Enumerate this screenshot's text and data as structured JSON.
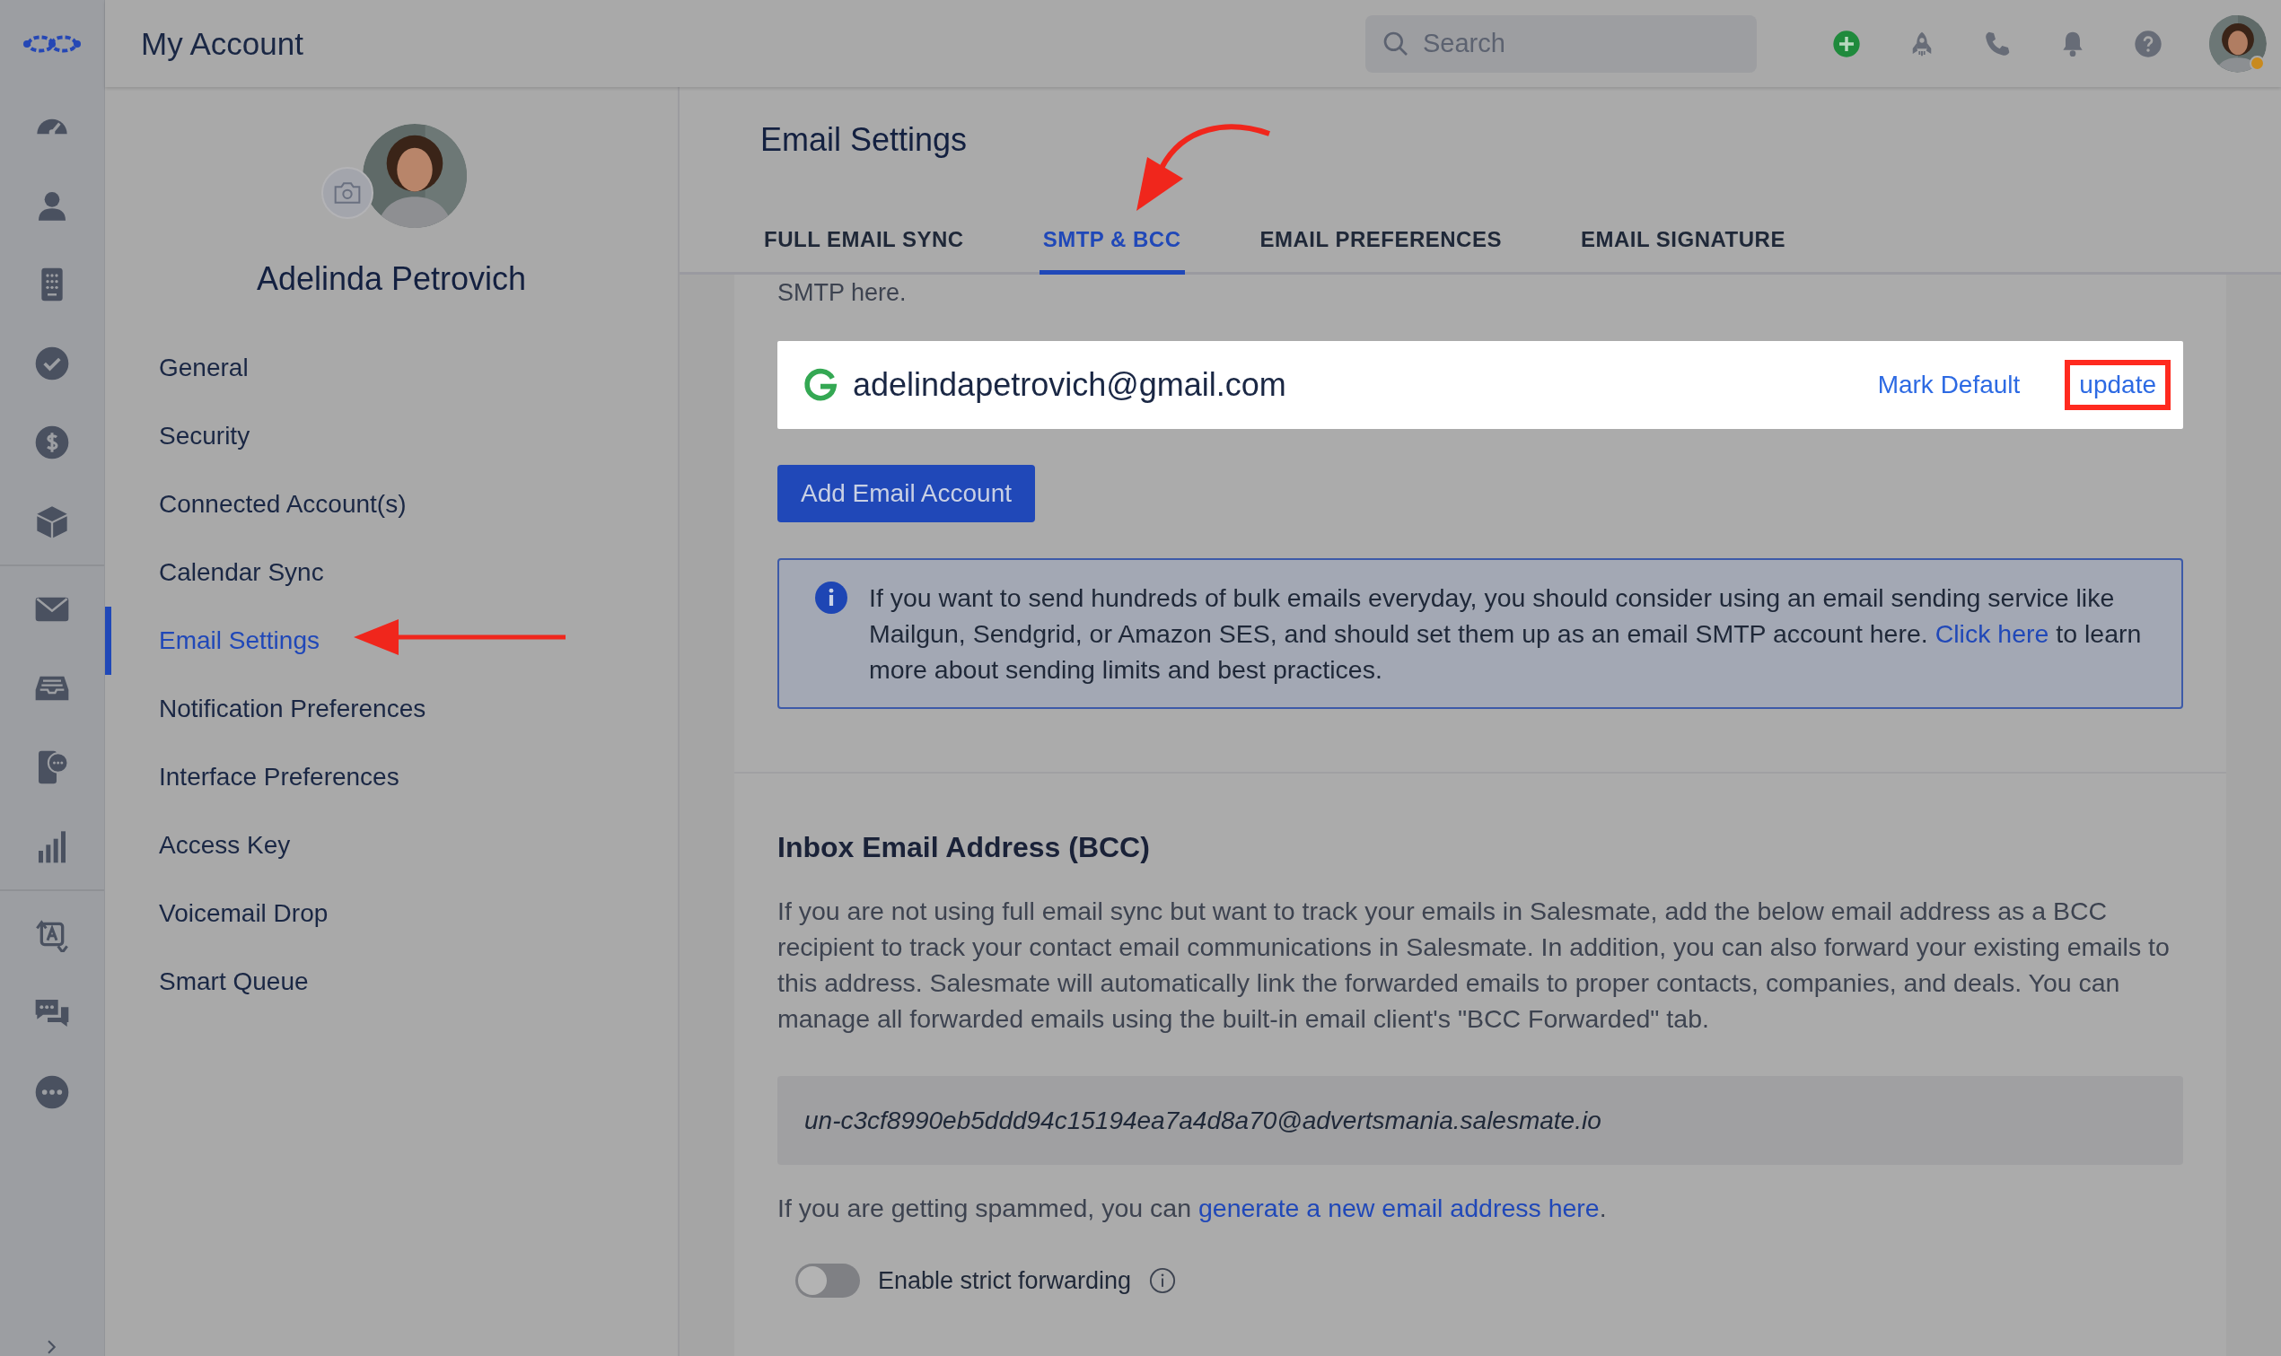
{
  "header": {
    "title": "My Account",
    "search": {
      "placeholder": "Search"
    }
  },
  "profile": {
    "name": "Adelinda Petrovich"
  },
  "settings_menu": [
    {
      "label": "General",
      "selected": false
    },
    {
      "label": "Security",
      "selected": false
    },
    {
      "label": "Connected Account(s)",
      "selected": false
    },
    {
      "label": "Calendar Sync",
      "selected": false
    },
    {
      "label": "Email Settings",
      "selected": true
    },
    {
      "label": "Notification Preferences",
      "selected": false
    },
    {
      "label": "Interface Preferences",
      "selected": false
    },
    {
      "label": "Access Key",
      "selected": false
    },
    {
      "label": "Voicemail Drop",
      "selected": false
    },
    {
      "label": "Smart Queue",
      "selected": false
    }
  ],
  "page": {
    "title": "Email Settings",
    "tabs": [
      {
        "label": "FULL EMAIL SYNC",
        "selected": false
      },
      {
        "label": "SMTP & BCC",
        "selected": true
      },
      {
        "label": "EMAIL PREFERENCES",
        "selected": false
      },
      {
        "label": "EMAIL SIGNATURE",
        "selected": false
      }
    ],
    "smtp_note": "SMTP here.",
    "accounts": [
      {
        "email": "adelindapetrovich@gmail.com",
        "mark_default": "Mark Default",
        "update": "update"
      }
    ],
    "add_button": "Add Email Account",
    "info": {
      "before": "If you want to send hundreds of bulk emails everyday, you should consider using an email sending service like Mailgun, Sendgrid, or Amazon SES, and should set them up as an email SMTP account here.",
      "link": "Click here",
      "after": "to learn more about sending limits and best practices."
    }
  },
  "bcc": {
    "title": "Inbox Email Address (BCC)",
    "description": "If you are not using full email sync but want to track your emails in Salesmate, add the below email address as a BCC recipient to track your contact email communications in Salesmate. In addition, you can also forward your existing emails to this address. Salesmate will automatically link the forwarded emails to proper contacts, companies, and deals. You can manage all forwarded emails using the built-in email client's \"BCC Forwarded\" tab.",
    "address": "un-c3cf8990eb5ddd94c15194ea7a4d8a70@advertsmania.salesmate.io",
    "spam_text": "If you are getting spammed, you can",
    "spam_link": "generate a new email address here",
    "spam_end": ".",
    "strict_forwarding": {
      "label": "Enable strict forwarding",
      "on": false
    }
  }
}
